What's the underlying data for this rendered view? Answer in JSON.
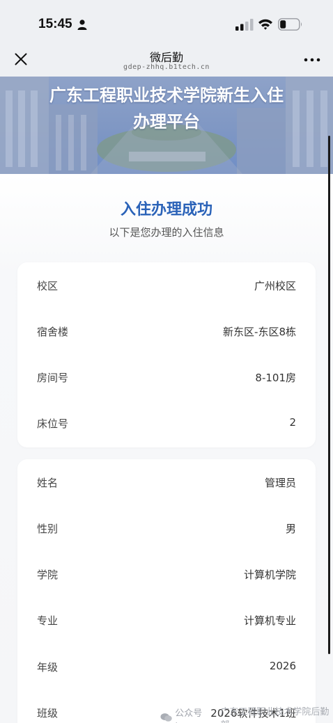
{
  "status_bar": {
    "time": "15:45"
  },
  "nav": {
    "title": "微后勤",
    "url": "gdep-zhhq.b1tech.cn"
  },
  "banner": {
    "title_line1": "广东工程职业技术学院新生入住",
    "title_line2": "办理平台"
  },
  "result": {
    "title": "入住办理成功",
    "subtitle": "以下是您办理的入住信息"
  },
  "dorm_info": [
    {
      "label": "校区",
      "value": "广州校区"
    },
    {
      "label": "宿舍楼",
      "value": "新东区-东区8栋"
    },
    {
      "label": "房间号",
      "value": "8-101房"
    },
    {
      "label": "床位号",
      "value": "2"
    }
  ],
  "student_info": [
    {
      "label": "姓名",
      "value": "管理员"
    },
    {
      "label": "性别",
      "value": "男"
    },
    {
      "label": "学院",
      "value": "计算机学院"
    },
    {
      "label": "专业",
      "value": "计算机专业"
    },
    {
      "label": "年级",
      "value": "2026"
    },
    {
      "label": "班级",
      "value": "2026软件技术1班"
    }
  ],
  "watermark": {
    "prefix": "公众号 ·",
    "account": "广东工程职业技术学院后勤部"
  },
  "colors": {
    "accent": "#2a62b8",
    "background": "#f5f6f8"
  }
}
